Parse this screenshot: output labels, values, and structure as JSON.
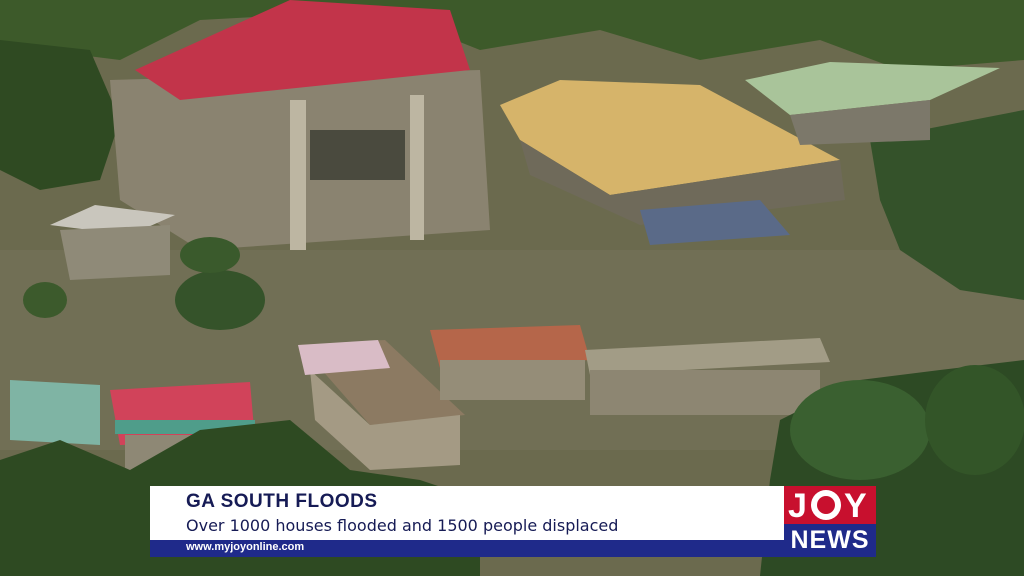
{
  "lower_third": {
    "headline": "GA SOUTH FLOODS",
    "subheadline": "Over 1000 houses flooded and 1500 people displaced",
    "url": "www.myjoyonline.com"
  },
  "logo": {
    "line1": "JOY",
    "line2": "NEWS"
  },
  "colors": {
    "brand_navy": "#1f2a8a",
    "brand_red": "#c8102e",
    "flood_water": "#6b6a4e"
  }
}
